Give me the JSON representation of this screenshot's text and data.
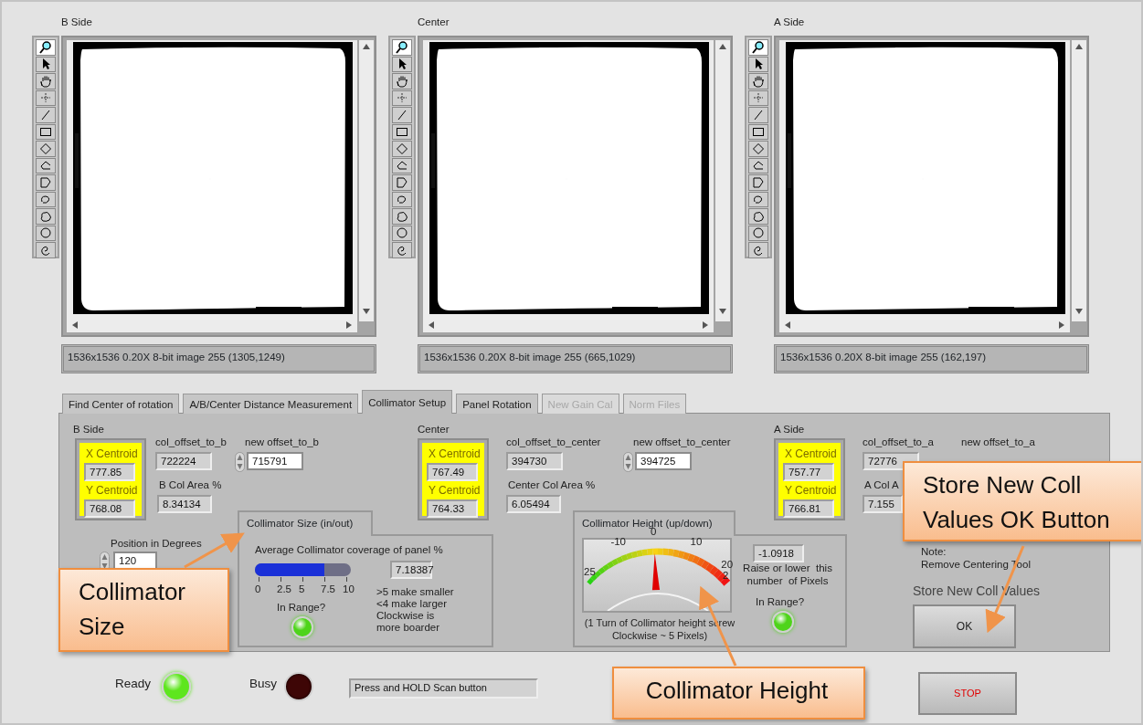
{
  "image_displays": [
    {
      "title": "B Side",
      "status": "1536x1536 0.20X 8-bit image 255    (1305,1249)"
    },
    {
      "title": "Center",
      "status": "1536x1536 0.20X 8-bit image 255    (665,1029)"
    },
    {
      "title": "A Side",
      "status": "1536x1536 0.20X 8-bit image 255    (162,197)"
    }
  ],
  "tabs": [
    {
      "label": "Find Center of rotation",
      "selected": false,
      "disabled": false
    },
    {
      "label": "A/B/Center Distance Measurement",
      "selected": false,
      "disabled": false
    },
    {
      "label": "Collimator Setup",
      "selected": true,
      "disabled": false
    },
    {
      "label": "Panel Rotation",
      "selected": false,
      "disabled": false
    },
    {
      "label": "New Gain Cal",
      "selected": false,
      "disabled": true
    },
    {
      "label": "Norm Files",
      "selected": false,
      "disabled": true
    }
  ],
  "sides": [
    {
      "title": "B Side",
      "x_label": "X Centroid",
      "x_value": "777.85",
      "y_label": "Y Centroid",
      "y_value": "768.08",
      "offset_label": "col_offset_to_b",
      "offset_value": "722224",
      "new_offset_label": "new offset_to_b",
      "new_offset_value": "715791",
      "area_label": "B Col Area %",
      "area_value": "8.34134"
    },
    {
      "title": "Center",
      "x_label": "X Centroid",
      "x_value": "767.49",
      "y_label": "Y Centroid",
      "y_value": "764.33",
      "offset_label": "col_offset_to_center",
      "offset_value": "394730",
      "new_offset_label": "new offset_to_center",
      "new_offset_value": "394725",
      "area_label": "Center Col Area %",
      "area_value": "6.05494"
    },
    {
      "title": "A Side",
      "x_label": "X Centroid",
      "x_value": "757.77",
      "y_label": "Y Centroid",
      "y_value": "766.81",
      "offset_label": "col_offset_to_a",
      "offset_value": "72776",
      "new_offset_label": "new offset_to_a",
      "area_label": "A Col A",
      "area_value": "7.155"
    }
  ],
  "position": {
    "label": "Position in Degrees",
    "value": "120"
  },
  "collimator_size": {
    "tab": "Collimator Size (in/out)",
    "label": "Average Collimator coverage of panel %",
    "value": "7.18387",
    "level": 0.72,
    "ticks": [
      "0",
      "2.5",
      "5",
      "7.5",
      "10"
    ],
    "in_range_label": "In Range?",
    "in_range_on": true,
    "notes": [
      ">5 make smaller",
      "<4 make larger",
      "Clockwise is",
      "more boarder"
    ]
  },
  "collimator_height": {
    "tab": "Collimator Height (up/down)",
    "gauge_ticks": [
      "25",
      "-10",
      "0",
      "10",
      "20",
      "2"
    ],
    "level": 0.48,
    "caption": "(1 Turn of Collimator height screw Clockwise ~ 5 Pixels)",
    "value": "-1.0918",
    "hint": "Raise or lower  this number  of Pixels",
    "in_range_label": "In Range?",
    "in_range_on": true
  },
  "note": [
    "Note:",
    "Remove Centering Tool"
  ],
  "store": {
    "label": "Store New Coll Values",
    "button": "OK"
  },
  "status_lights": [
    {
      "label": "Ready",
      "on": true,
      "color": "#5ee61e"
    },
    {
      "label": "Busy",
      "on": false,
      "color": "#3e0606"
    }
  ],
  "message": "Press and HOLD Scan button",
  "stop_button": "STOP",
  "callouts": [
    {
      "text": "Collimator Size"
    },
    {
      "text": "Collimator Height"
    },
    {
      "text": "Store New Coll Values OK Button"
    }
  ]
}
